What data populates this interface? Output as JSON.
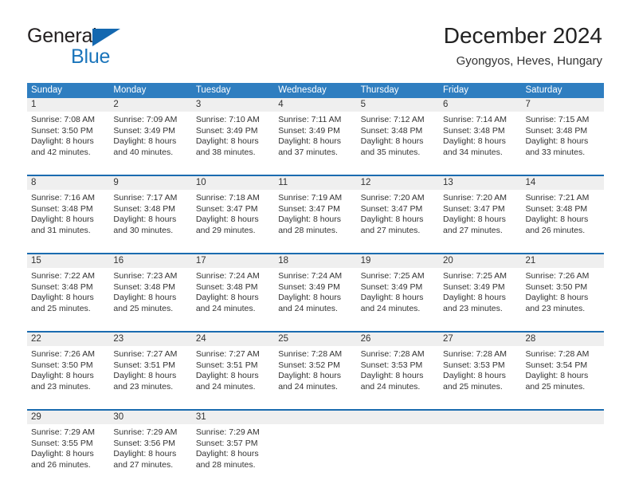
{
  "brand": {
    "name_part1": "General",
    "name_part2": "Blue",
    "triangle_icon": "triangle-icon",
    "color_dark": "#231f20",
    "color_blue": "#1b75bb"
  },
  "header": {
    "title": "December 2024",
    "subtitle": "Gyongyos, Heves, Hungary"
  },
  "theme": {
    "header_row_bg": "#2f7ec0",
    "day_strip_bg": "#efefef",
    "separator": "#1b6cb0"
  },
  "weekdays": [
    "Sunday",
    "Monday",
    "Tuesday",
    "Wednesday",
    "Thursday",
    "Friday",
    "Saturday"
  ],
  "weeks": [
    [
      {
        "day": "1",
        "sunrise": "Sunrise: 7:08 AM",
        "sunset": "Sunset: 3:50 PM",
        "daylight1": "Daylight: 8 hours",
        "daylight2": "and 42 minutes."
      },
      {
        "day": "2",
        "sunrise": "Sunrise: 7:09 AM",
        "sunset": "Sunset: 3:49 PM",
        "daylight1": "Daylight: 8 hours",
        "daylight2": "and 40 minutes."
      },
      {
        "day": "3",
        "sunrise": "Sunrise: 7:10 AM",
        "sunset": "Sunset: 3:49 PM",
        "daylight1": "Daylight: 8 hours",
        "daylight2": "and 38 minutes."
      },
      {
        "day": "4",
        "sunrise": "Sunrise: 7:11 AM",
        "sunset": "Sunset: 3:49 PM",
        "daylight1": "Daylight: 8 hours",
        "daylight2": "and 37 minutes."
      },
      {
        "day": "5",
        "sunrise": "Sunrise: 7:12 AM",
        "sunset": "Sunset: 3:48 PM",
        "daylight1": "Daylight: 8 hours",
        "daylight2": "and 35 minutes."
      },
      {
        "day": "6",
        "sunrise": "Sunrise: 7:14 AM",
        "sunset": "Sunset: 3:48 PM",
        "daylight1": "Daylight: 8 hours",
        "daylight2": "and 34 minutes."
      },
      {
        "day": "7",
        "sunrise": "Sunrise: 7:15 AM",
        "sunset": "Sunset: 3:48 PM",
        "daylight1": "Daylight: 8 hours",
        "daylight2": "and 33 minutes."
      }
    ],
    [
      {
        "day": "8",
        "sunrise": "Sunrise: 7:16 AM",
        "sunset": "Sunset: 3:48 PM",
        "daylight1": "Daylight: 8 hours",
        "daylight2": "and 31 minutes."
      },
      {
        "day": "9",
        "sunrise": "Sunrise: 7:17 AM",
        "sunset": "Sunset: 3:48 PM",
        "daylight1": "Daylight: 8 hours",
        "daylight2": "and 30 minutes."
      },
      {
        "day": "10",
        "sunrise": "Sunrise: 7:18 AM",
        "sunset": "Sunset: 3:47 PM",
        "daylight1": "Daylight: 8 hours",
        "daylight2": "and 29 minutes."
      },
      {
        "day": "11",
        "sunrise": "Sunrise: 7:19 AM",
        "sunset": "Sunset: 3:47 PM",
        "daylight1": "Daylight: 8 hours",
        "daylight2": "and 28 minutes."
      },
      {
        "day": "12",
        "sunrise": "Sunrise: 7:20 AM",
        "sunset": "Sunset: 3:47 PM",
        "daylight1": "Daylight: 8 hours",
        "daylight2": "and 27 minutes."
      },
      {
        "day": "13",
        "sunrise": "Sunrise: 7:20 AM",
        "sunset": "Sunset: 3:47 PM",
        "daylight1": "Daylight: 8 hours",
        "daylight2": "and 27 minutes."
      },
      {
        "day": "14",
        "sunrise": "Sunrise: 7:21 AM",
        "sunset": "Sunset: 3:48 PM",
        "daylight1": "Daylight: 8 hours",
        "daylight2": "and 26 minutes."
      }
    ],
    [
      {
        "day": "15",
        "sunrise": "Sunrise: 7:22 AM",
        "sunset": "Sunset: 3:48 PM",
        "daylight1": "Daylight: 8 hours",
        "daylight2": "and 25 minutes."
      },
      {
        "day": "16",
        "sunrise": "Sunrise: 7:23 AM",
        "sunset": "Sunset: 3:48 PM",
        "daylight1": "Daylight: 8 hours",
        "daylight2": "and 25 minutes."
      },
      {
        "day": "17",
        "sunrise": "Sunrise: 7:24 AM",
        "sunset": "Sunset: 3:48 PM",
        "daylight1": "Daylight: 8 hours",
        "daylight2": "and 24 minutes."
      },
      {
        "day": "18",
        "sunrise": "Sunrise: 7:24 AM",
        "sunset": "Sunset: 3:49 PM",
        "daylight1": "Daylight: 8 hours",
        "daylight2": "and 24 minutes."
      },
      {
        "day": "19",
        "sunrise": "Sunrise: 7:25 AM",
        "sunset": "Sunset: 3:49 PM",
        "daylight1": "Daylight: 8 hours",
        "daylight2": "and 24 minutes."
      },
      {
        "day": "20",
        "sunrise": "Sunrise: 7:25 AM",
        "sunset": "Sunset: 3:49 PM",
        "daylight1": "Daylight: 8 hours",
        "daylight2": "and 23 minutes."
      },
      {
        "day": "21",
        "sunrise": "Sunrise: 7:26 AM",
        "sunset": "Sunset: 3:50 PM",
        "daylight1": "Daylight: 8 hours",
        "daylight2": "and 23 minutes."
      }
    ],
    [
      {
        "day": "22",
        "sunrise": "Sunrise: 7:26 AM",
        "sunset": "Sunset: 3:50 PM",
        "daylight1": "Daylight: 8 hours",
        "daylight2": "and 23 minutes."
      },
      {
        "day": "23",
        "sunrise": "Sunrise: 7:27 AM",
        "sunset": "Sunset: 3:51 PM",
        "daylight1": "Daylight: 8 hours",
        "daylight2": "and 23 minutes."
      },
      {
        "day": "24",
        "sunrise": "Sunrise: 7:27 AM",
        "sunset": "Sunset: 3:51 PM",
        "daylight1": "Daylight: 8 hours",
        "daylight2": "and 24 minutes."
      },
      {
        "day": "25",
        "sunrise": "Sunrise: 7:28 AM",
        "sunset": "Sunset: 3:52 PM",
        "daylight1": "Daylight: 8 hours",
        "daylight2": "and 24 minutes."
      },
      {
        "day": "26",
        "sunrise": "Sunrise: 7:28 AM",
        "sunset": "Sunset: 3:53 PM",
        "daylight1": "Daylight: 8 hours",
        "daylight2": "and 24 minutes."
      },
      {
        "day": "27",
        "sunrise": "Sunrise: 7:28 AM",
        "sunset": "Sunset: 3:53 PM",
        "daylight1": "Daylight: 8 hours",
        "daylight2": "and 25 minutes."
      },
      {
        "day": "28",
        "sunrise": "Sunrise: 7:28 AM",
        "sunset": "Sunset: 3:54 PM",
        "daylight1": "Daylight: 8 hours",
        "daylight2": "and 25 minutes."
      }
    ],
    [
      {
        "day": "29",
        "sunrise": "Sunrise: 7:29 AM",
        "sunset": "Sunset: 3:55 PM",
        "daylight1": "Daylight: 8 hours",
        "daylight2": "and 26 minutes."
      },
      {
        "day": "30",
        "sunrise": "Sunrise: 7:29 AM",
        "sunset": "Sunset: 3:56 PM",
        "daylight1": "Daylight: 8 hours",
        "daylight2": "and 27 minutes."
      },
      {
        "day": "31",
        "sunrise": "Sunrise: 7:29 AM",
        "sunset": "Sunset: 3:57 PM",
        "daylight1": "Daylight: 8 hours",
        "daylight2": "and 28 minutes."
      },
      {
        "day": "",
        "sunrise": "",
        "sunset": "",
        "daylight1": "",
        "daylight2": ""
      },
      {
        "day": "",
        "sunrise": "",
        "sunset": "",
        "daylight1": "",
        "daylight2": ""
      },
      {
        "day": "",
        "sunrise": "",
        "sunset": "",
        "daylight1": "",
        "daylight2": ""
      },
      {
        "day": "",
        "sunrise": "",
        "sunset": "",
        "daylight1": "",
        "daylight2": ""
      }
    ]
  ]
}
